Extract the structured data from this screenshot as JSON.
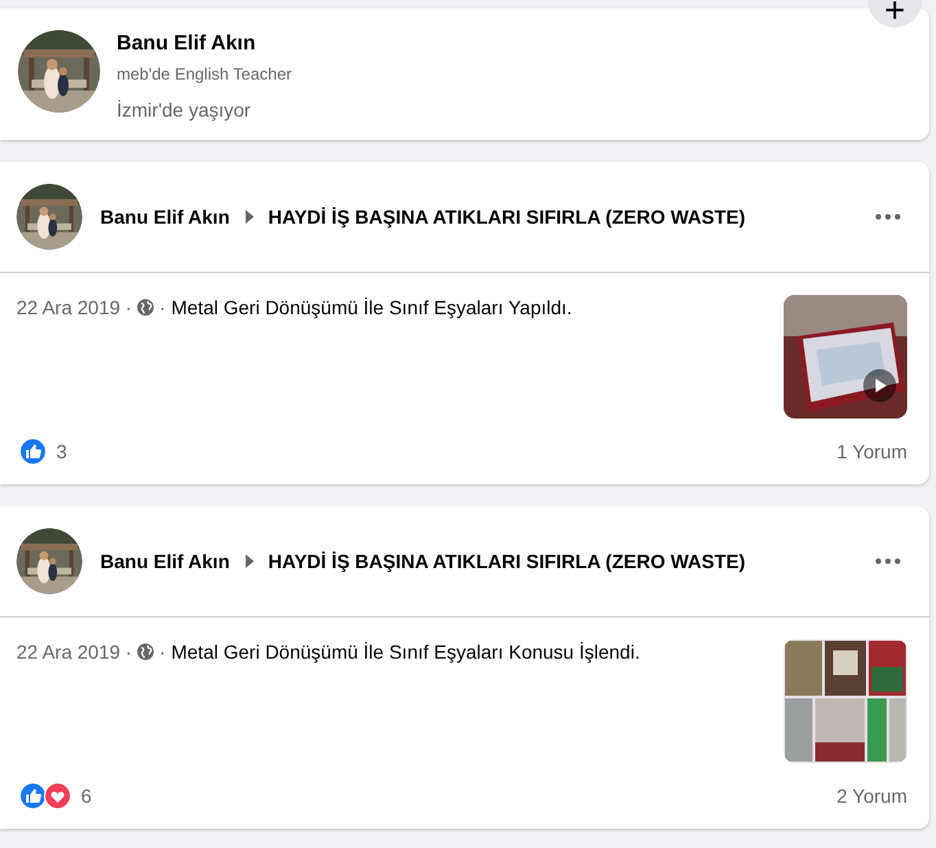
{
  "profile": {
    "name": "Banu Elif Akın",
    "work": "meb'de English Teacher",
    "location": "İzmir'de yaşıyor"
  },
  "add_button": {
    "label": "+"
  },
  "posts": [
    {
      "author": "Banu Elif Akın",
      "group": "HAYDİ İŞ BAŞINA ATIKLARI SIFIRLA (ZERO WASTE)",
      "date": "22 Ara 2019 ·",
      "separator": "·",
      "text": "Metal Geri Dönüşümü İle Sınıf Eşyaları Yapıldı.",
      "thumbnail": {
        "video": true
      },
      "reactions": [
        {
          "kind": "like"
        }
      ],
      "reaction_count": "3",
      "comments": "1 Yorum"
    },
    {
      "author": "Banu Elif Akın",
      "group": "HAYDİ İŞ BAŞINA ATIKLARI SIFIRLA (ZERO WASTE)",
      "date": "22 Ara 2019 ·",
      "separator": "·",
      "text": "Metal Geri Dönüşümü İle Sınıf Eşyaları Konusu İşlendi.",
      "thumbnail": {
        "video": false
      },
      "reactions": [
        {
          "kind": "like"
        },
        {
          "kind": "love"
        }
      ],
      "reaction_count": "6",
      "comments": "2 Yorum"
    }
  ]
}
